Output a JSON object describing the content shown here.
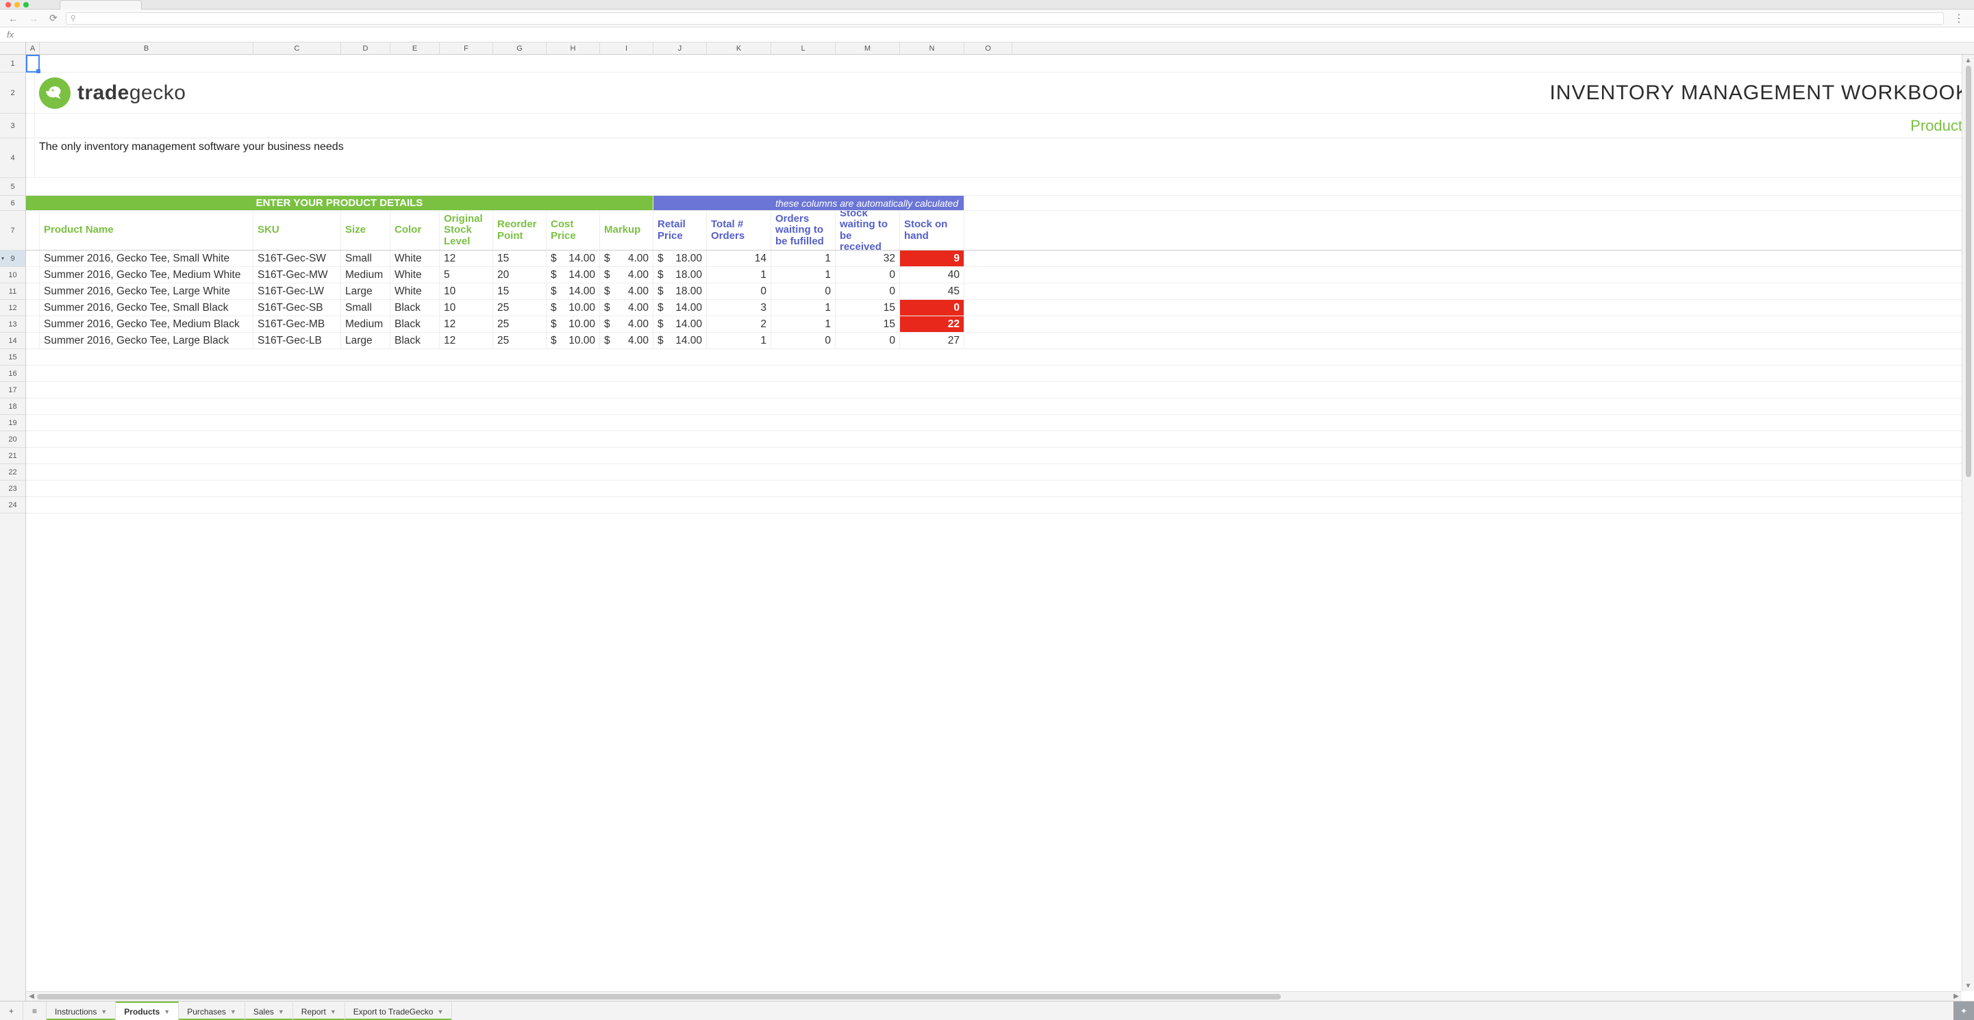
{
  "brand": {
    "name_prefix": "trade",
    "name_suffix": "gecko",
    "tagline": "The only inventory management software your business needs"
  },
  "page": {
    "title": "INVENTORY MANAGEMENT  WORKBOOK",
    "subtitle": "Products"
  },
  "formula_prefix": "fx",
  "omnibox_icon": "⚲",
  "sections": {
    "green_label": "ENTER YOUR PRODUCT DETAILS",
    "blue_label": "these  columns are automatically calculated"
  },
  "columns": {
    "letters": [
      "A",
      "B",
      "C",
      "D",
      "E",
      "F",
      "G",
      "H",
      "I",
      "J",
      "K",
      "L",
      "M",
      "N",
      "O"
    ],
    "widths": [
      20,
      312,
      128,
      72,
      72,
      78,
      78,
      78,
      78,
      78,
      94,
      94,
      94,
      94,
      70
    ]
  },
  "row_headers": {
    "selected": 9,
    "heights": {
      "1": 26,
      "2": 60,
      "3": 36,
      "4": 58,
      "5": 26,
      "6": 22,
      "7": 58,
      "9": 24,
      "10": 24,
      "11": 24,
      "12": 24,
      "13": 24,
      "14": 24,
      "15": 24,
      "16": 24,
      "17": 24,
      "18": 24,
      "19": 24,
      "20": 24,
      "21": 24,
      "22": 24,
      "23": 24,
      "24": 24
    }
  },
  "table": {
    "headers_green": [
      "Product Name",
      "SKU",
      "Size",
      "Color",
      "Original Stock Level",
      "Reorder Point",
      "Cost Price",
      "Markup"
    ],
    "headers_blue": [
      "Retail Price",
      "Total # Orders",
      "Orders waiting to be fufilled",
      "Stock waiting to be received",
      "Stock on hand"
    ],
    "rows": [
      {
        "name": "Summer 2016, Gecko Tee, Small White",
        "sku": "S16T-Gec-SW",
        "size": "Small",
        "color": "White",
        "orig": "12",
        "reorder": "15",
        "cost": "14.00",
        "markup": "4.00",
        "retail": "18.00",
        "orders": "14",
        "waiting_fulfill": "1",
        "waiting_receive": "32",
        "on_hand": "9",
        "alert": true
      },
      {
        "name": "Summer 2016, Gecko Tee, Medium White",
        "sku": "S16T-Gec-MW",
        "size": "Medium",
        "color": "White",
        "orig": "5",
        "reorder": "20",
        "cost": "14.00",
        "markup": "4.00",
        "retail": "18.00",
        "orders": "1",
        "waiting_fulfill": "1",
        "waiting_receive": "0",
        "on_hand": "40",
        "alert": false
      },
      {
        "name": "Summer 2016, Gecko Tee, Large White",
        "sku": "S16T-Gec-LW",
        "size": "Large",
        "color": "White",
        "orig": "10",
        "reorder": "15",
        "cost": "14.00",
        "markup": "4.00",
        "retail": "18.00",
        "orders": "0",
        "waiting_fulfill": "0",
        "waiting_receive": "0",
        "on_hand": "45",
        "alert": false
      },
      {
        "name": "Summer 2016, Gecko Tee, Small Black",
        "sku": "S16T-Gec-SB",
        "size": "Small",
        "color": "Black",
        "orig": "10",
        "reorder": "25",
        "cost": "10.00",
        "markup": "4.00",
        "retail": "14.00",
        "orders": "3",
        "waiting_fulfill": "1",
        "waiting_receive": "15",
        "on_hand": "0",
        "alert": true
      },
      {
        "name": "Summer 2016, Gecko Tee, Medium Black",
        "sku": "S16T-Gec-MB",
        "size": "Medium",
        "color": "Black",
        "orig": "12",
        "reorder": "25",
        "cost": "10.00",
        "markup": "4.00",
        "retail": "14.00",
        "orders": "2",
        "waiting_fulfill": "1",
        "waiting_receive": "15",
        "on_hand": "22",
        "alert": true
      },
      {
        "name": "Summer 2016, Gecko Tee, Large Black",
        "sku": "S16T-Gec-LB",
        "size": "Large",
        "color": "Black",
        "orig": "12",
        "reorder": "25",
        "cost": "10.00",
        "markup": "4.00",
        "retail": "14.00",
        "orders": "1",
        "waiting_fulfill": "0",
        "waiting_receive": "0",
        "on_hand": "27",
        "alert": false
      }
    ]
  },
  "currency_symbol": "$",
  "tabs": [
    {
      "label": "Instructions",
      "active": false
    },
    {
      "label": "Products",
      "active": true
    },
    {
      "label": "Purchases",
      "active": false
    },
    {
      "label": "Sales",
      "active": false
    },
    {
      "label": "Report",
      "active": false
    },
    {
      "label": "Export to TradeGecko",
      "active": false
    }
  ],
  "add_sheet_label": "+",
  "all_sheets_label": "≡"
}
